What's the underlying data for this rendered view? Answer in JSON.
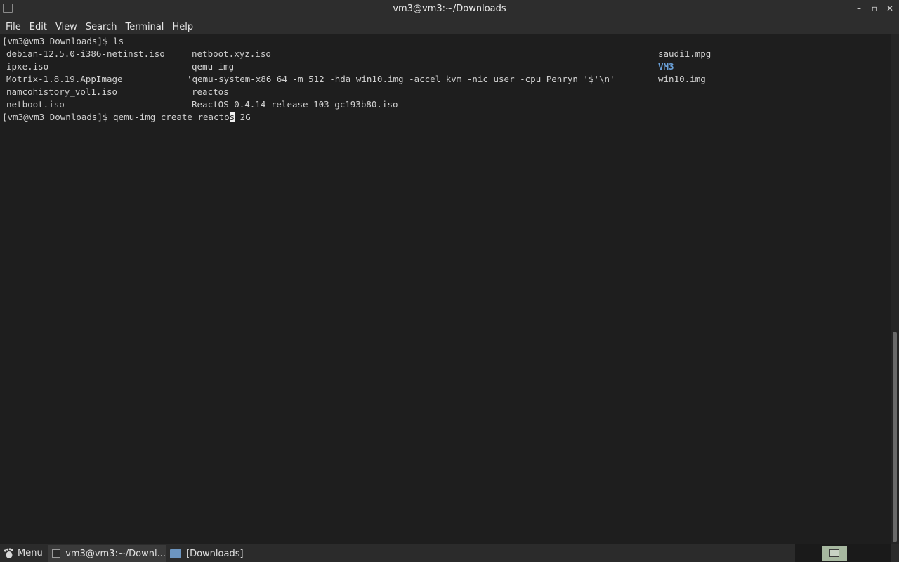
{
  "window": {
    "title": "vm3@vm3:~/Downloads",
    "icon": "terminal-app-icon",
    "controls": {
      "minimize": "–",
      "maximize": "▫",
      "close": "✕"
    }
  },
  "menubar": {
    "items": [
      "File",
      "Edit",
      "View",
      "Search",
      "Terminal",
      "Help"
    ]
  },
  "terminal": {
    "prompt_1": "[vm3@vm3 Downloads]$ ls",
    "ls_rows": [
      [
        "debian-12.5.0-i386-netinst.iso",
        "netboot.xyz.iso",
        "saudi1.mpg"
      ],
      [
        "ipxe.iso",
        "qemu-img",
        "VM3"
      ],
      [
        "Motrix-1.8.19.AppImage",
        "'qemu-system-x86_64 -m 512 -hda win10.img -accel kvm -nic user -cpu Penryn '$'\\n'",
        "win10.img"
      ],
      [
        "namcohistory_vol1.iso",
        "reactos",
        ""
      ],
      [
        "netboot.iso",
        "ReactOS-0.4.14-release-103-gc193b80.iso",
        ""
      ]
    ],
    "prompt_2_before_cursor": "[vm3@vm3 Downloads]$ qemu-img create reacto",
    "cursor_char": "s",
    "prompt_2_after_cursor": " 2G"
  },
  "taskbar": {
    "menu_label": "Menu",
    "menu_icon": "gnome-foot-icon",
    "tasks": [
      {
        "label": "vm3@vm3:~/Downl...",
        "icon": "terminal-icon",
        "active": true
      },
      {
        "label": "[Downloads]",
        "icon": "folder-icon",
        "active": false
      }
    ]
  },
  "colors": {
    "background": "#1e1e1e",
    "text": "#d0d0d0",
    "directory": "#6aa0d8",
    "chrome": "#2d2d2d"
  }
}
